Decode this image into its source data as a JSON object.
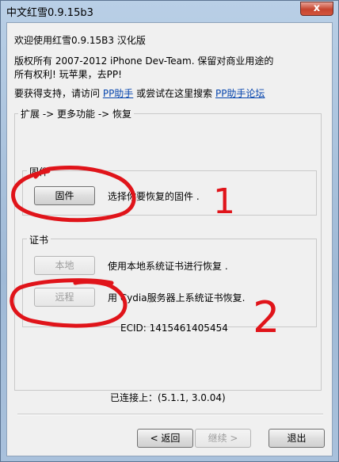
{
  "window": {
    "title": "中文红雪0.9.15b3",
    "close_glyph": "x"
  },
  "intro": {
    "welcome": "欢迎使用红雪0.9.15B3 汉化版",
    "copyright_line1": "版权所有 2007-2012 iPhone Dev-Team. 保留对商业用途的",
    "copyright_line2": "所有权利!   玩苹果，去PP!",
    "support_prefix": "要获得支持，请访问 ",
    "support_link1": "PP助手",
    "support_mid": " 或尝试在这里搜索 ",
    "support_link2": "PP助手论坛"
  },
  "breadcrumb": "扩展 -> 更多功能 -> 恢复",
  "firmware_group": {
    "label": "固件",
    "button": "固件",
    "description": "选择你要恢复的固件 ."
  },
  "cert_group": {
    "label": "证书",
    "local_button": "本地",
    "local_description": "使用本地系统证书进行恢复 .",
    "remote_button": "远程",
    "remote_description": "用 Cydia服务器上系统证书恢复.",
    "ecid": "ECID: 1415461405454"
  },
  "status": "已连接上：(5.1.1, 3.0.04)",
  "nav": {
    "back": "< 返回",
    "next": "继续 >",
    "exit": "退出"
  },
  "annotations": {
    "number1": "1",
    "number2": "2",
    "ink_color": "#e0141a"
  }
}
